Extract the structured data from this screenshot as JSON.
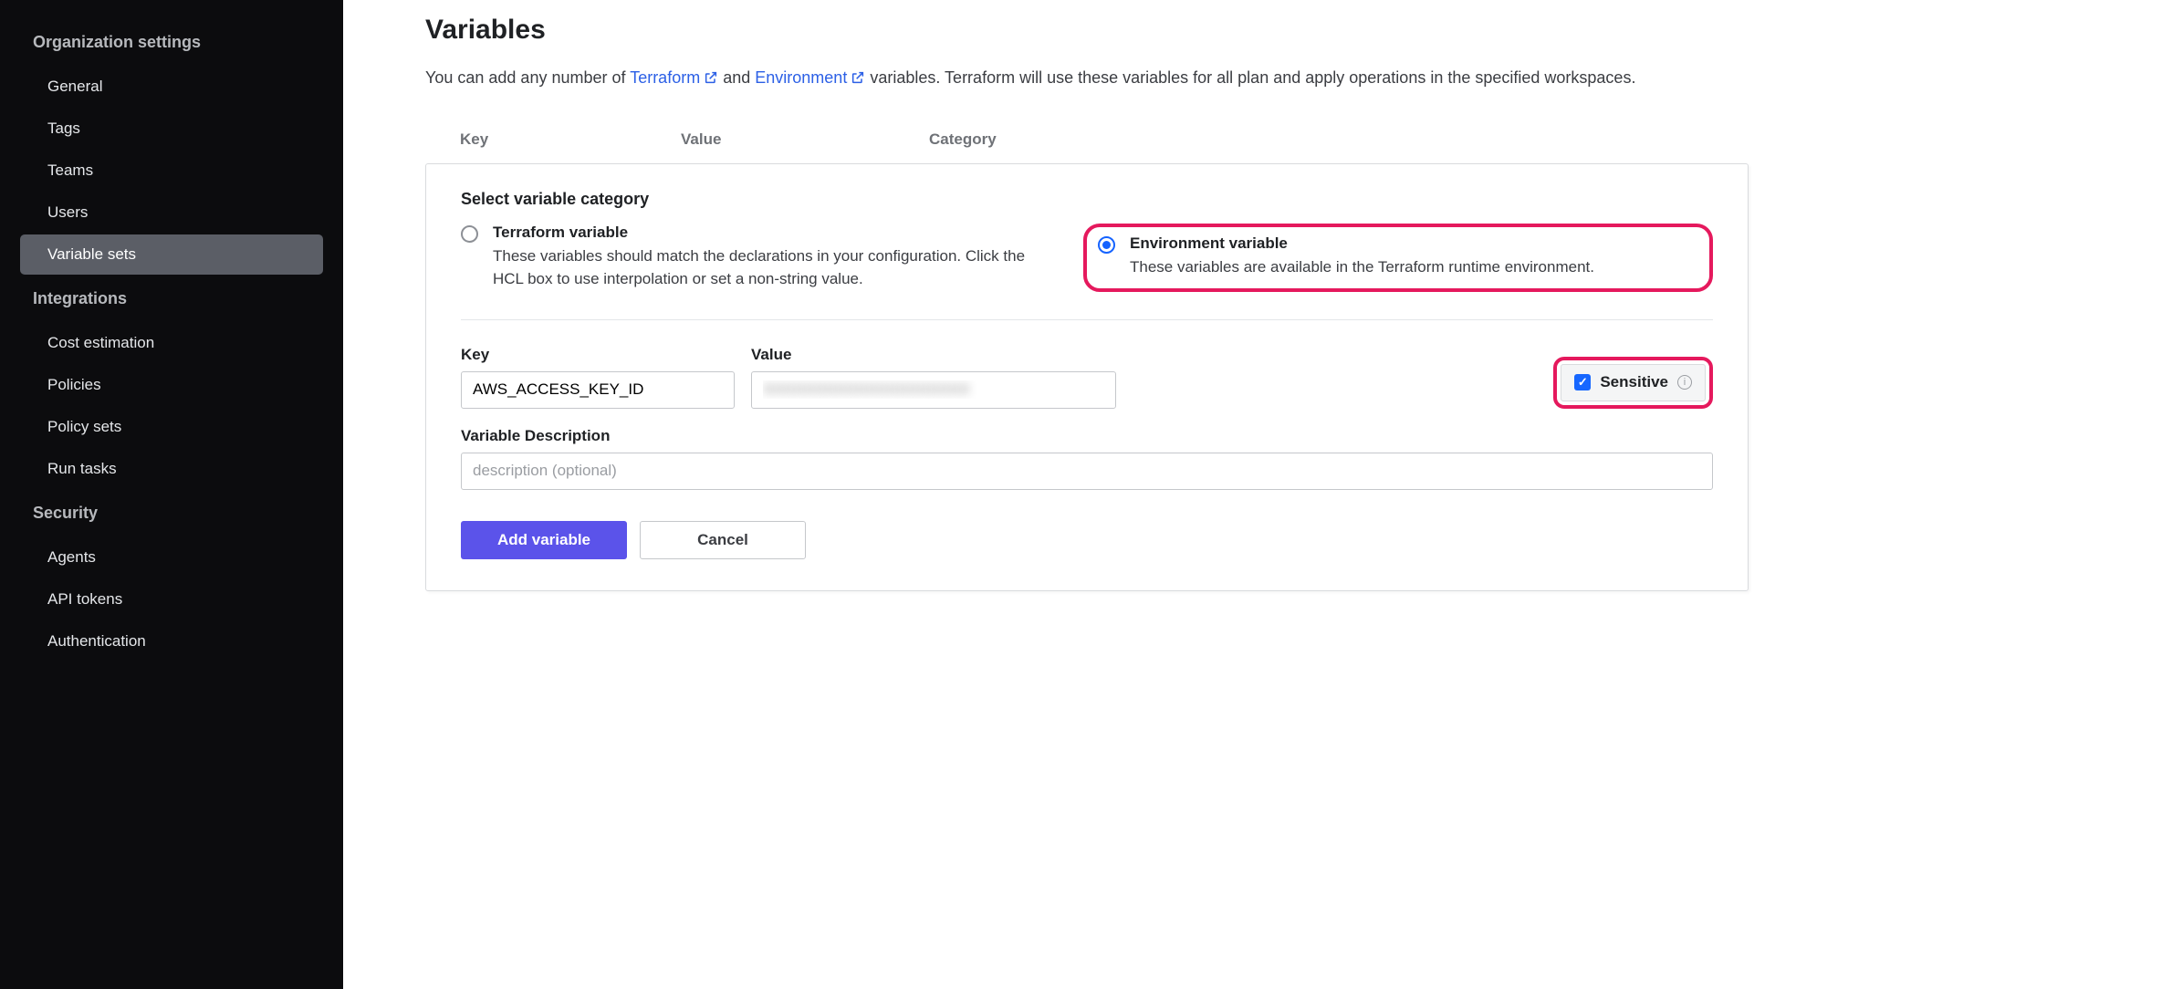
{
  "sidebar": {
    "sections": [
      {
        "title": "Organization settings",
        "items": [
          "General",
          "Tags",
          "Teams",
          "Users",
          "Variable sets"
        ],
        "active": "Variable sets"
      },
      {
        "title": "Integrations",
        "items": [
          "Cost estimation",
          "Policies",
          "Policy sets",
          "Run tasks"
        ]
      },
      {
        "title": "Security",
        "items": [
          "Agents",
          "API tokens",
          "Authentication"
        ]
      }
    ]
  },
  "page": {
    "title": "Variables",
    "intro_1": "You can add any number of ",
    "link_terraform": "Terraform",
    "intro_2": " and ",
    "link_environment": "Environment",
    "intro_3": " variables. Terraform will use these variables for all plan and apply operations in the specified workspaces."
  },
  "table": {
    "key": "Key",
    "value": "Value",
    "category": "Category"
  },
  "form": {
    "select_category": "Select variable category",
    "radio1": {
      "title": "Terraform variable",
      "desc": "These variables should match the declarations in your configuration. Click the HCL box to use interpolation or set a non-string value."
    },
    "radio2": {
      "title": "Environment variable",
      "desc": "These variables are available in the Terraform runtime environment."
    },
    "key_label": "Key",
    "key_value": "AWS_ACCESS_KEY_ID",
    "value_label": "Value",
    "value_value": "XXXXXXXXXXXXXXXXXXXX",
    "sensitive_label": "Sensitive",
    "desc_label": "Variable Description",
    "desc_placeholder": "description (optional)",
    "add_btn": "Add variable",
    "cancel_btn": "Cancel"
  }
}
